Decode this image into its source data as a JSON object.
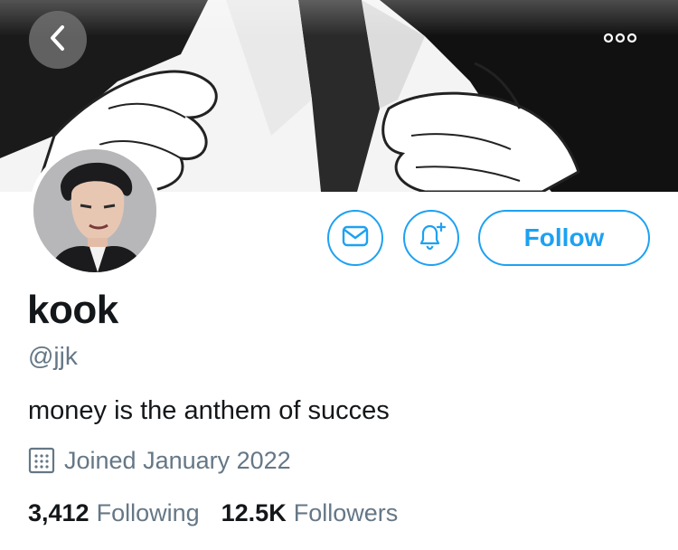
{
  "profile": {
    "name": "kook",
    "handle": "@jjk",
    "bio": "money is the anthem of succes",
    "joined": "Joined January 2022"
  },
  "actions": {
    "follow_label": "Follow"
  },
  "stats": {
    "following_count": "3,412",
    "following_label": "Following",
    "followers_count": "12.5K",
    "followers_label": "Followers"
  },
  "icons": {
    "back": "chevron-left-icon",
    "more": "more-dots-icon",
    "message": "mail-icon",
    "notify": "bell-plus-icon",
    "joined": "calendar-icon"
  },
  "colors": {
    "accent": "#1da1f2",
    "secondary_text": "#657786",
    "primary_text": "#14171a"
  }
}
